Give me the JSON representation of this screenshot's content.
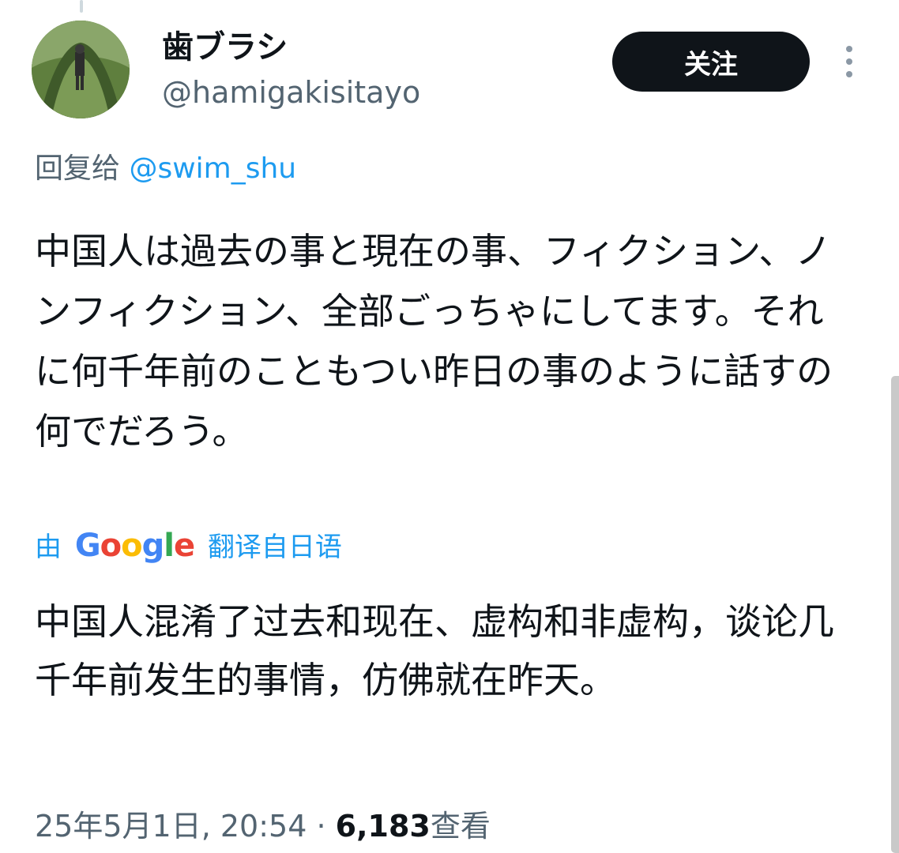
{
  "author": {
    "display_name": "歯ブラシ",
    "handle": "@hamigakisitayo"
  },
  "follow_button_label": "关注",
  "reply": {
    "prefix": "回复给",
    "mention": "@swim_shu"
  },
  "tweet": {
    "text": "中国人は過去の事と現在の事、フィクション、ノンフィクション、全部ごっちゃにしてます。それに何千年前のこともつい昨日の事のように話すの何でだろう。"
  },
  "translation": {
    "prefix": "由",
    "provider_letters": [
      "G",
      "o",
      "o",
      "g",
      "l",
      "e"
    ],
    "suffix": "翻译自日语",
    "text": "中国人混淆了过去和现在、虚构和非虚构，谈论几千年前发生的事情，仿佛就在昨天。"
  },
  "meta": {
    "timestamp": "25年5月1日, 20:54",
    "separator": "·",
    "views_count": "6,183",
    "views_label": "查看"
  },
  "colors": {
    "accent": "#1d9bf0",
    "secondary_text": "#536471",
    "primary_text": "#0f1419",
    "button_bg": "#0f1419"
  }
}
